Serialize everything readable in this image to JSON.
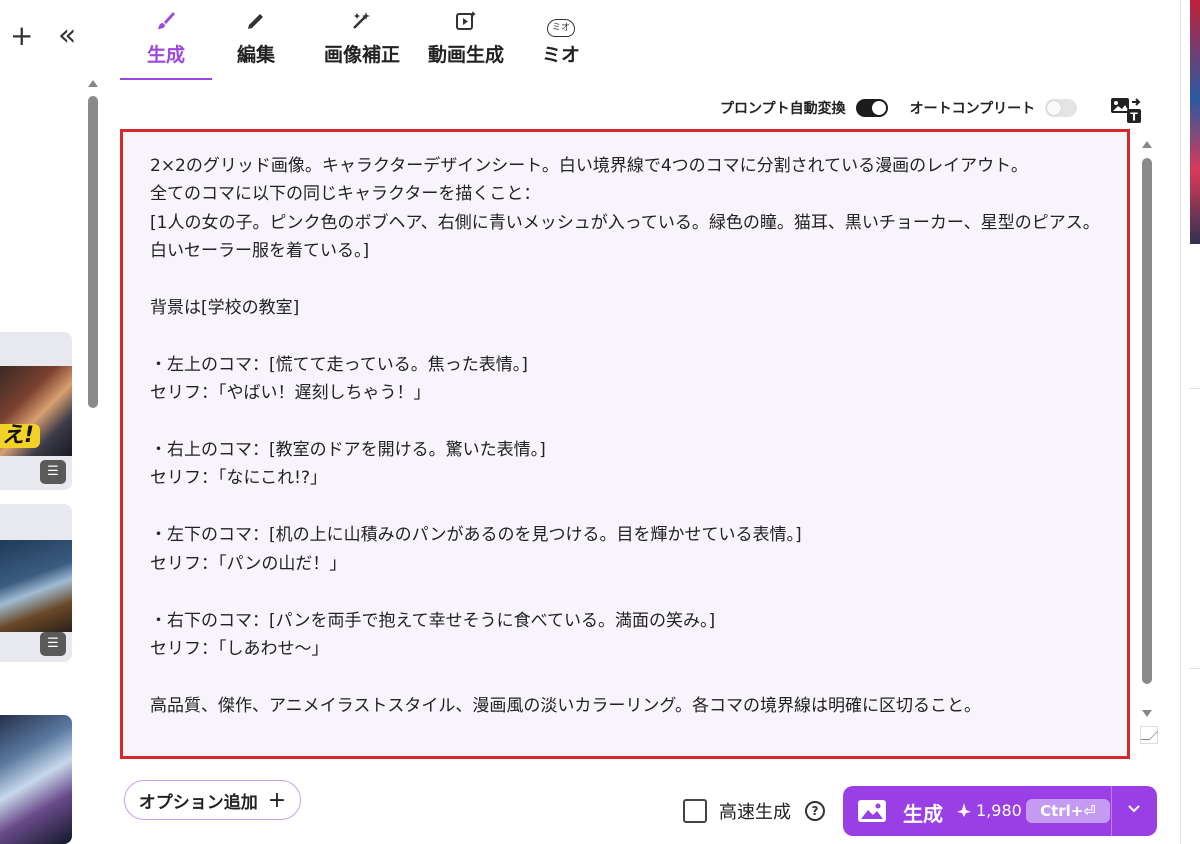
{
  "toolbar_left": {
    "add_icon": "plus-icon",
    "collapse_icon": "double-chevron-left-icon"
  },
  "tabs": [
    {
      "label": "生成",
      "icon": "brush-icon",
      "active": true
    },
    {
      "label": "編集",
      "icon": "pencil-icon",
      "active": false
    },
    {
      "label": "画像補正",
      "icon": "sparkle-wand-icon",
      "active": false
    },
    {
      "label": "動画生成",
      "icon": "video-sparkle-icon",
      "active": false
    },
    {
      "label": "ミオ",
      "icon": "mio-cat-icon",
      "icon_text": "ミオ",
      "active": false
    }
  ],
  "options": {
    "prompt_auto_convert": {
      "label": "プロンプト自動変換",
      "on": true
    },
    "autocomplete": {
      "label": "オートコンプリート",
      "on": false
    },
    "image_to_text_icon": "image-to-text-icon"
  },
  "prompt": {
    "text": "2×2のグリッド画像。キャラクターデザインシート。白い境界線で4つのコマに分割されている漫画のレイアウト。\n全てのコマに以下の同じキャラクターを描くこと：\n[1人の女の子。ピンク色のボブヘア、右側に青いメッシュが入っている。緑色の瞳。猫耳、黒いチョーカー、星型のピアス。白いセーラー服を着ている。]\n\n背景は[学校の教室]\n\n・左上のコマ：[慌てて走っている。焦った表情。]\nセリフ：「やばい！遅刻しちゃう！」\n\n・右上のコマ：[教室のドアを開ける。驚いた表情。]\nセリフ：「なにこれ!?」\n\n・左下のコマ：[机の上に山積みのパンがあるのを見つける。目を輝かせている表情。]\nセリフ：「パンの山だ！」\n\n・右下のコマ：[パンを両手で抱えて幸せそうに食べている。満面の笑み。]\nセリフ：「しあわせ～」\n\n高品質、傑作、アニメイラストスタイル、漫画風の淡いカラーリング。各コマの境界線は明確に区切ること。"
  },
  "bottom": {
    "option_add_label": "オプション追加",
    "fast_gen_label": "高速生成",
    "fast_gen_checked": false,
    "help_icon": "question-circle-icon",
    "generate_label": "生成",
    "credits": "1,980",
    "shortcut": "Ctrl+⏎",
    "dropdown_icon": "chevron-down-icon"
  },
  "thumbnails": [
    {
      "icon": "comment-icon",
      "burst_text": "え!"
    },
    {
      "icon": "comment-icon"
    },
    {
      "icon": ""
    }
  ],
  "colors": {
    "accent": "#9a3ee6",
    "highlight_border": "#d42a2a",
    "prompt_bg": "#f8f4fc"
  }
}
